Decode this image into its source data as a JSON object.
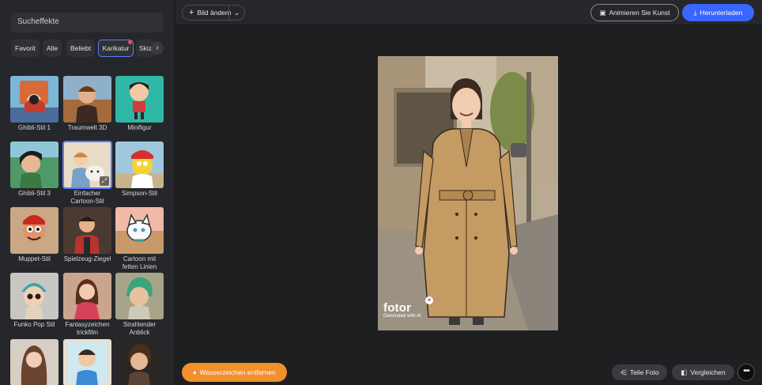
{
  "sidebar": {
    "search_placeholder": "Sucheffekte",
    "categories": [
      "Favorit",
      "Alle",
      "Beliebt",
      "Karikatur",
      "Skizze"
    ],
    "next_icon": "chevron-right-icon",
    "effects": [
      {
        "label": "Ghibli-Stil 1"
      },
      {
        "label": "Traumwelt 3D"
      },
      {
        "label": "Minifigur"
      },
      {
        "label": "Ghibli-Stil 3"
      },
      {
        "label": "Einfacher Cartoon-Stil",
        "selected": true
      },
      {
        "label": "Simpson-Stil"
      },
      {
        "label": "Muppet-Stil"
      },
      {
        "label": "Spielzeug-Ziegel"
      },
      {
        "label": "Cartoon mit fetten Linien"
      },
      {
        "label": "Funko Pop Stil"
      },
      {
        "label": "Fantasyzeichen trickfilm"
      },
      {
        "label": "Strahlender Anblick"
      },
      {
        "label": ""
      },
      {
        "label": ""
      },
      {
        "label": ""
      }
    ]
  },
  "topbar": {
    "change_image": "Bild ändern",
    "animate": "Animieren Sie Kunst",
    "download": "Herunterladen"
  },
  "canvas": {
    "watermark_logo": "fotor",
    "watermark_sub": "Generated with AI",
    "remove_watermark": "Wasserzeichen entfernen",
    "share": "Teile Foto",
    "compare": "Vergleichen",
    "more": "•••"
  },
  "colors": {
    "accent_blue": "#3a66ff",
    "accent_orange": "#f2902c",
    "selection": "#5b7cff"
  }
}
